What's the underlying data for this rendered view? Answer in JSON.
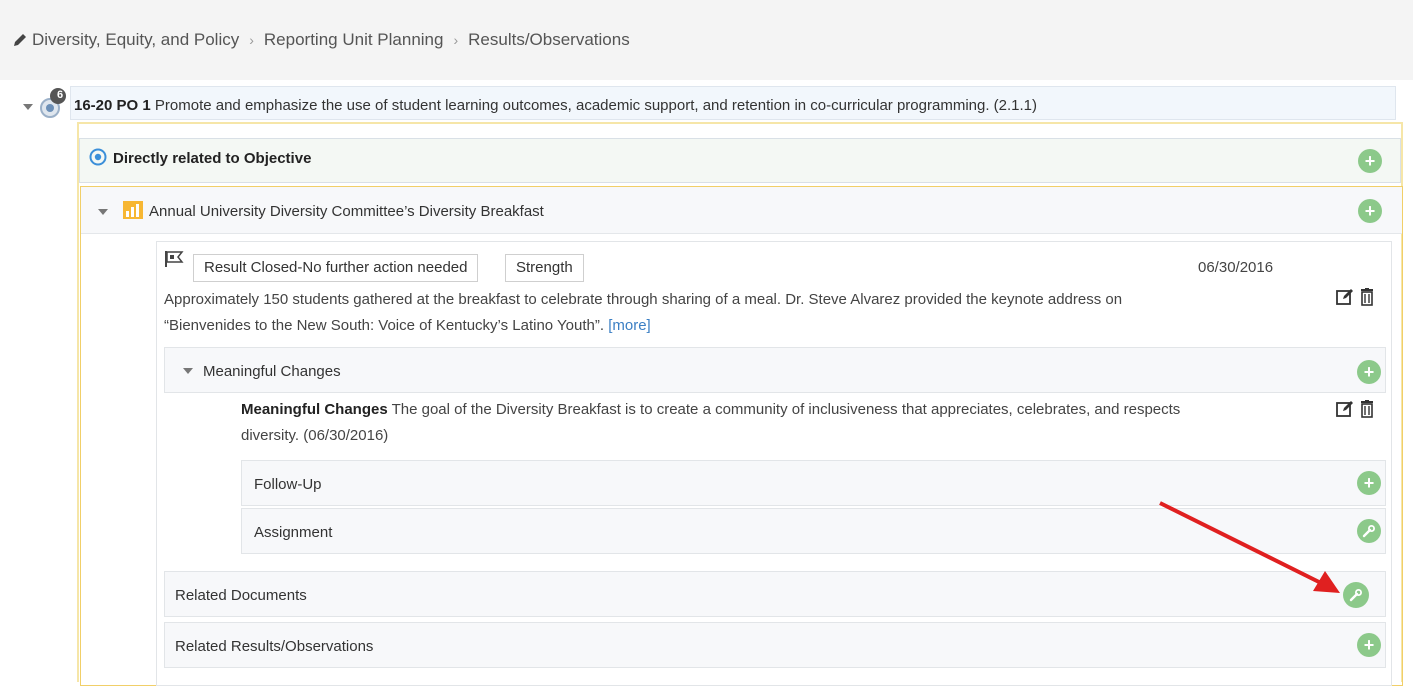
{
  "breadcrumb": {
    "items": [
      "Diversity, Equity, and Policy",
      "Reporting Unit Planning",
      "Results/Observations"
    ]
  },
  "objective": {
    "badge_count": "6",
    "code": "16-20 PO 1",
    "text": "Promote and emphasize the use of student learning outcomes, academic support, and retention in co-curricular programming. (2.1.1)"
  },
  "directly_related": {
    "label": "Directly related to Objective"
  },
  "measure": {
    "label": "Annual University Diversity Committee’s Diversity Breakfast"
  },
  "result": {
    "status_tag": "Result Closed-No further action needed",
    "type_tag": "Strength",
    "date": "06/30/2016",
    "text_line1": "Approximately 150 students gathered at the breakfast to celebrate through sharing of a meal. Dr. Steve Alvarez provided the keynote address on",
    "text_line2": "“Bienvenides to the New South: Voice of Kentucky’s Latino Youth”.",
    "more_link": "[more]"
  },
  "meaningful_changes": {
    "header": "Meaningful Changes",
    "entry_title": "Meaningful Changes",
    "entry_text_line1": "The goal of the Diversity Breakfast is to create a community of inclusiveness that appreciates, celebrates, and respects",
    "entry_text_line2": "diversity. (06/30/2016)",
    "follow_up_label": "Follow-Up",
    "assignment_label": "Assignment"
  },
  "related_documents": {
    "label": "Related Documents"
  },
  "related_results": {
    "label": "Related Results/Observations"
  },
  "colors": {
    "accent_green": "#8cc98a",
    "highlight_yellow": "#f1cf68",
    "link_blue": "#3b7fc4",
    "annotation_arrow": "#e02020"
  },
  "icons": [
    "pencil-icon",
    "caret-down-icon",
    "objective-badge-icon",
    "target-icon",
    "bar-chart-icon",
    "flag-icon",
    "edit-icon",
    "trash-icon",
    "plus-icon",
    "wrench-icon"
  ]
}
